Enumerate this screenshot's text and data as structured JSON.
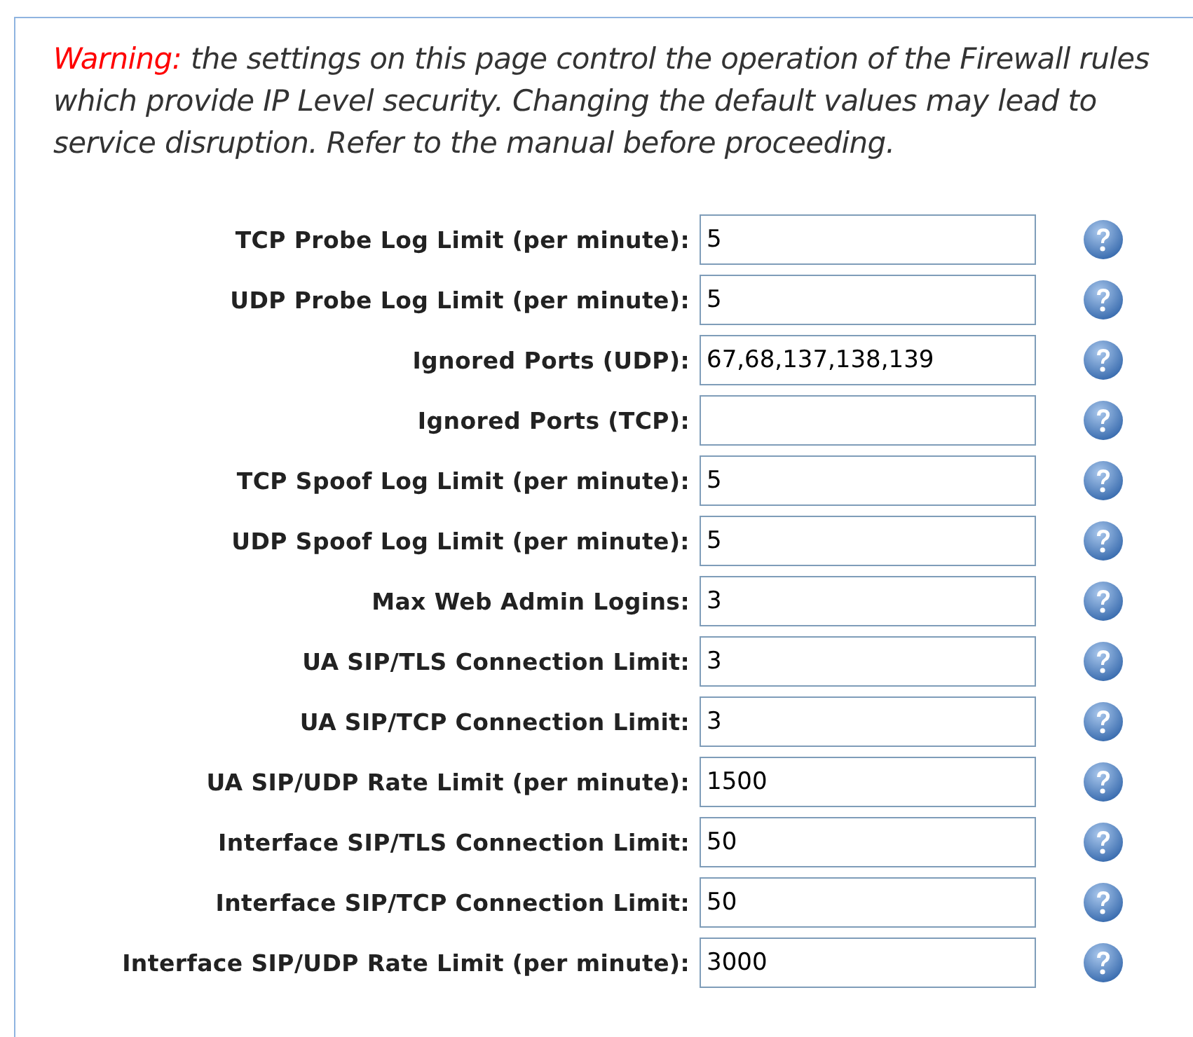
{
  "warning": {
    "label": "Warning:",
    "text": "the settings on this page control the operation of the Firewall rules which provide IP Level security. Changing the default values may lead to service disruption. Refer to the manual before proceeding."
  },
  "fields": [
    {
      "label": "TCP Probe Log Limit (per minute):",
      "value": "5"
    },
    {
      "label": "UDP Probe Log Limit (per minute):",
      "value": "5"
    },
    {
      "label": "Ignored Ports (UDP):",
      "value": "67,68,137,138,139"
    },
    {
      "label": "Ignored Ports (TCP):"
    },
    {
      "label": "TCP Spoof Log Limit (per minute):",
      "value": "5"
    },
    {
      "label": "UDP Spoof Log Limit (per minute):",
      "value": "5"
    },
    {
      "label": "Max Web Admin Logins:",
      "value": "3"
    },
    {
      "label": "UA SIP/TLS Connection Limit:",
      "value": "3"
    },
    {
      "label": "UA SIP/TCP Connection Limit:",
      "value": "3"
    },
    {
      "label": "UA SIP/UDP Rate Limit (per minute):",
      "value": "1500"
    },
    {
      "label": "Interface SIP/TLS Connection Limit:",
      "value": "50"
    },
    {
      "label": "Interface SIP/TCP Connection Limit:",
      "value": "50"
    },
    {
      "label": "Interface SIP/UDP Rate Limit (per minute):",
      "value": "3000"
    }
  ]
}
